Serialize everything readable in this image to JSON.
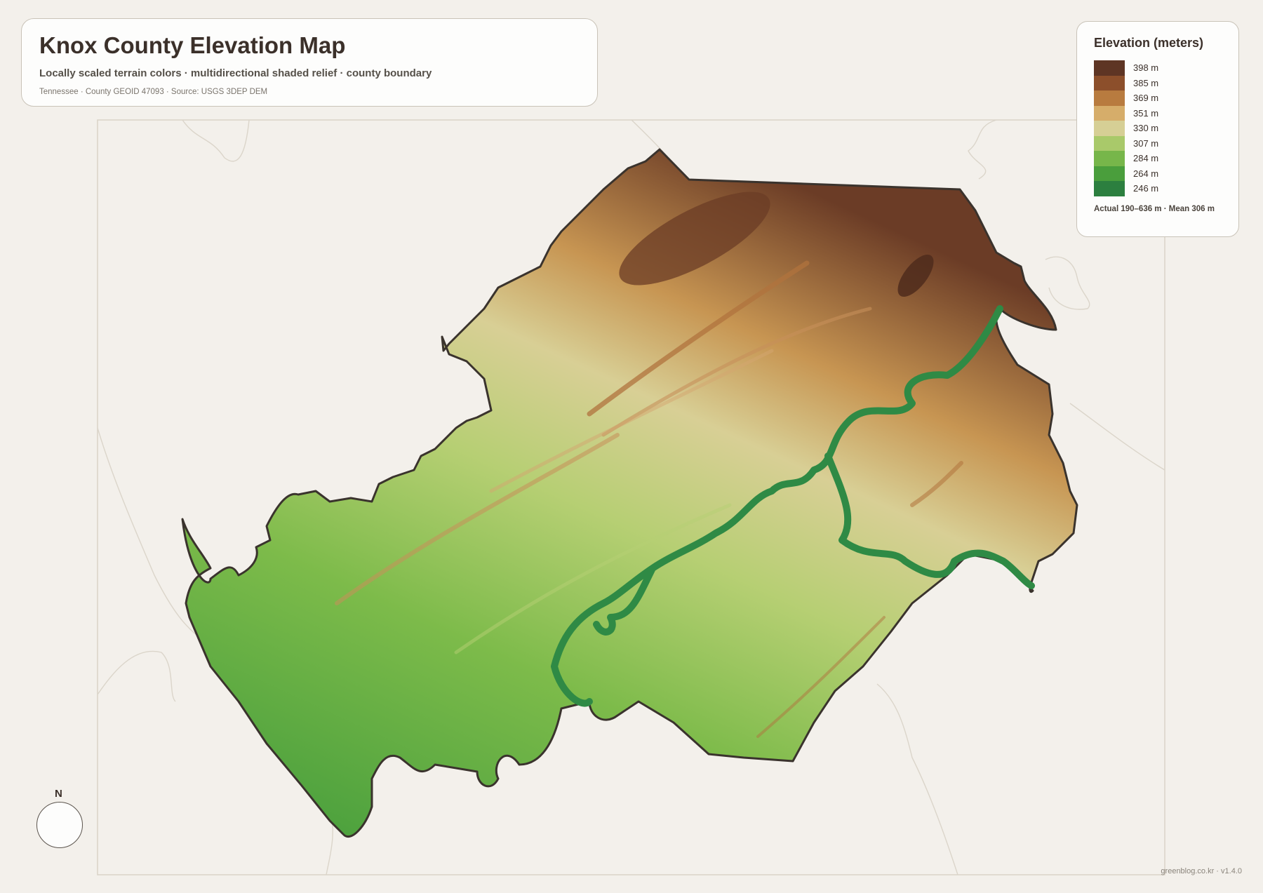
{
  "header": {
    "title": "Knox County Elevation Map",
    "subtitle": "Locally scaled terrain colors · multidirectional shaded relief · county boundary",
    "meta": "Tennessee · County GEOID 47093 · Source: USGS 3DEP DEM"
  },
  "legend": {
    "title": "Elevation (meters)",
    "items": [
      {
        "label": "398 m",
        "color": "#5e3524"
      },
      {
        "label": "385 m",
        "color": "#8c4f2b"
      },
      {
        "label": "369 m",
        "color": "#b87b3f"
      },
      {
        "label": "351 m",
        "color": "#d6ad6a"
      },
      {
        "label": "330 m",
        "color": "#d6cf95"
      },
      {
        "label": "307 m",
        "color": "#a9c96a"
      },
      {
        "label": "284 m",
        "color": "#77b64a"
      },
      {
        "label": "264 m",
        "color": "#4a9e3c"
      },
      {
        "label": "246 m",
        "color": "#2c7f3f"
      }
    ],
    "footnote": "Actual 190–636 m · Mean 306 m"
  },
  "compass": {
    "label": "N"
  },
  "credit": "greenblog.co.kr · v1.4.0",
  "map": {
    "county_name": "Knox County",
    "state": "Tennessee",
    "colors": {
      "background": "#f3f0eb",
      "boundary": "#3a332d",
      "neighbor_lines": "#d9d3c8",
      "river": "#2f8a45"
    }
  }
}
